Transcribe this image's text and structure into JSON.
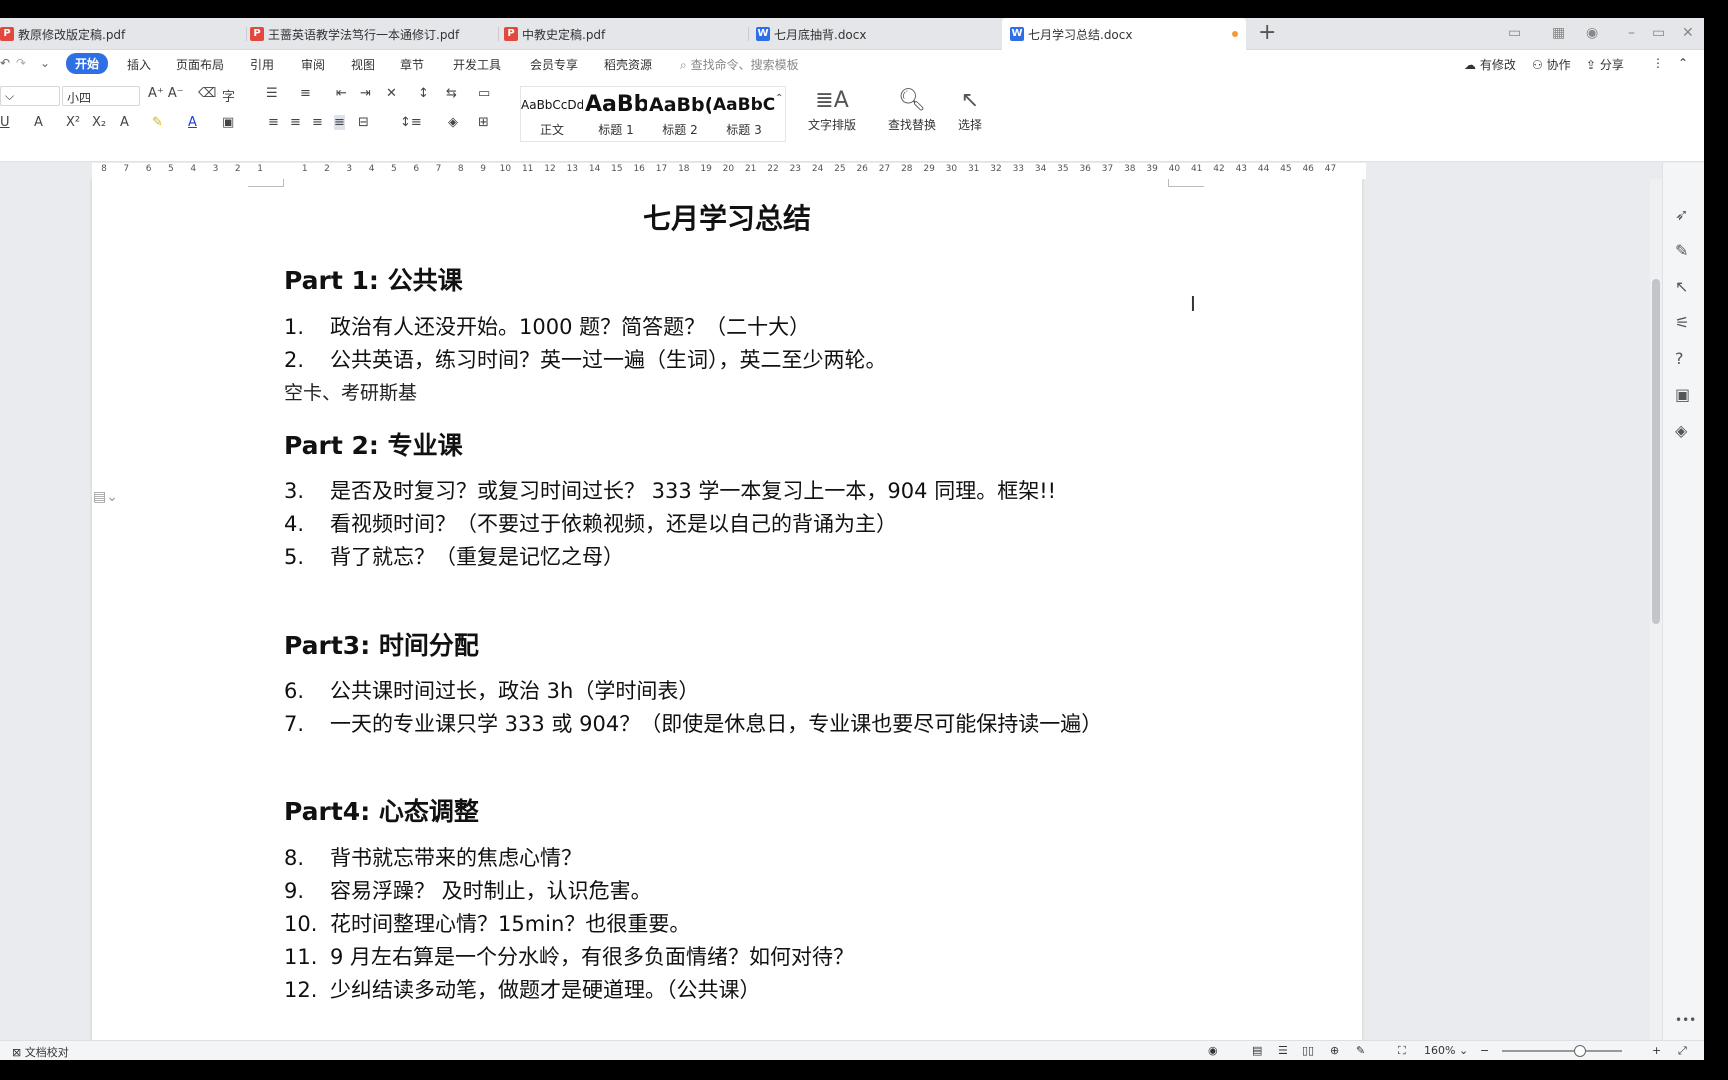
{
  "tabs": [
    {
      "label": "教原修改版定稿.pdf",
      "type": "pdf"
    },
    {
      "label": "王蔷英语教学法笃行一本通修订.pdf",
      "type": "pdf"
    },
    {
      "label": "中教史定稿.pdf",
      "type": "pdf"
    },
    {
      "label": "七月底抽背.docx",
      "type": "doc"
    },
    {
      "label": "七月学习总结.docx",
      "type": "doc",
      "active": true
    }
  ],
  "new_tab": "+",
  "menu": {
    "items": [
      "开始",
      "插入",
      "页面布局",
      "引用",
      "审阅",
      "视图",
      "章节",
      "开发工具",
      "会员专享",
      "稻壳资源"
    ],
    "search_placeholder": "查找命令、搜索模板",
    "right": {
      "modify": "有修改",
      "collab": "协作",
      "share": "分享"
    }
  },
  "ribbon": {
    "font_size": "小四",
    "styles": [
      {
        "sample": "AaBbCcDd",
        "name": "正文"
      },
      {
        "sample": "AaBb",
        "name": "标题 1"
      },
      {
        "sample": "AaBb(",
        "name": "标题 2"
      },
      {
        "sample": "AaBbC(",
        "name": "标题 3"
      }
    ],
    "text_layout": "文字排版",
    "find_replace": "查找替换",
    "select": "选择"
  },
  "ruler_ticks": [
    "8",
    "7",
    "6",
    "5",
    "4",
    "3",
    "2",
    "1",
    "",
    "1",
    "2",
    "3",
    "4",
    "5",
    "6",
    "7",
    "8",
    "9",
    "10",
    "11",
    "12",
    "13",
    "14",
    "15",
    "16",
    "17",
    "18",
    "19",
    "20",
    "21",
    "22",
    "23",
    "24",
    "25",
    "26",
    "27",
    "28",
    "29",
    "30",
    "31",
    "32",
    "33",
    "34",
    "35",
    "36",
    "37",
    "38",
    "39",
    "40",
    "41",
    "42",
    "43",
    "44",
    "45",
    "46",
    "47"
  ],
  "document": {
    "title": "七月学习总结",
    "part1": "Part 1:  公共课",
    "line1": {
      "num": "1.",
      "text": "政治有人还没开始。1000 题？简答题？（二十大）"
    },
    "line2": {
      "num": "2.",
      "text": "公共英语，练习时间？英一过一遍（生词），英二至少两轮。"
    },
    "note1": "空卡、考研斯基",
    "part2": "Part 2:  专业课",
    "line3": {
      "num": "3.",
      "text": "是否及时复习？或复习时间过长？   333  学一本复习上一本，904 同理。框架!!"
    },
    "line4": {
      "num": "4.",
      "text": "看视频时间？（不要过于依赖视频，还是以自己的背诵为主）"
    },
    "line5": {
      "num": "5.",
      "text": "背了就忘？（重复是记忆之母）"
    },
    "part3": "Part3:  时间分配",
    "line6": {
      "num": "6.",
      "text": "公共课时间过长，政治 3h（学时间表）"
    },
    "line7": {
      "num": "7.",
      "text": "一天的专业课只学 333 或 904？（即使是休息日，专业课也要尽可能保持读一遍）"
    },
    "part4": "Part4:  心态调整",
    "line8": {
      "num": "8.",
      "text": "背书就忘带来的焦虑心情？"
    },
    "line9": {
      "num": "9.",
      "text": "容易浮躁？   及时制止，认识危害。"
    },
    "line10": {
      "num": "10.",
      "text": "花时间整理心情？15min？也很重要。"
    },
    "line11": {
      "num": "11.",
      "text": "9 月左右算是一个分水岭，有很多负面情绪？如何对待？"
    },
    "line12": {
      "num": "12.",
      "text": "少纠结读多动笔，做题才是硬道理。（公共课）"
    }
  },
  "status": {
    "proofread": "文档校对",
    "zoom": "160%"
  },
  "colors": {
    "accent": "#2f6fe4",
    "pdf": "#e2483d",
    "doc": "#2e6ee6",
    "modified_dot": "#f29a36"
  }
}
